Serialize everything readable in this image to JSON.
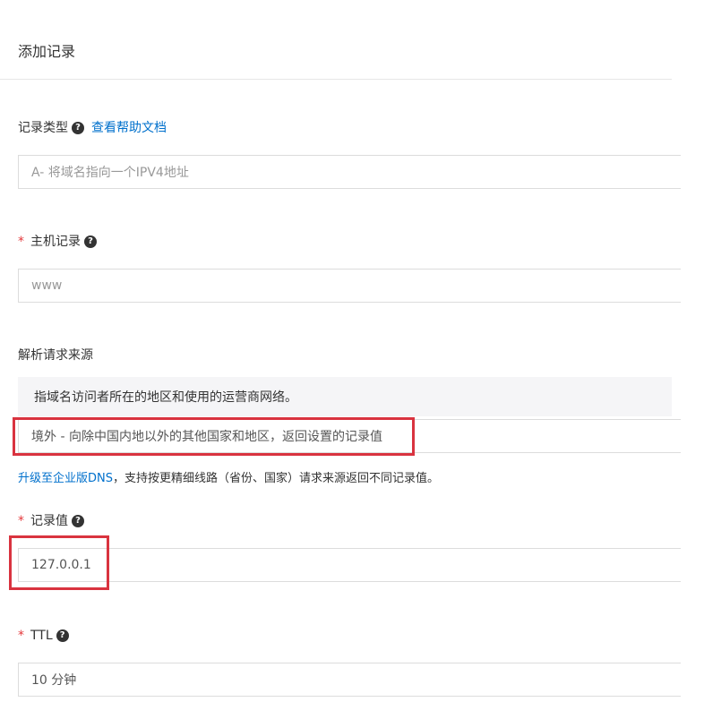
{
  "dialog": {
    "title": "添加记录"
  },
  "record_type": {
    "label": "记录类型",
    "help_link": "查看帮助文档",
    "value": "A- 将域名指向一个IPV4地址"
  },
  "host_record": {
    "required_mark": "*",
    "label": "主机记录",
    "value": "www"
  },
  "request_source": {
    "label": "解析请求来源",
    "hint": "指域名访问者所在的地区和使用的运营商网络。",
    "value": "境外 - 向除中国内地以外的其他国家和地区，返回设置的记录值",
    "upgrade_link": "升级至企业版DNS",
    "upgrade_note": "，支持按更精细线路（省份、国家）请求来源返回不同记录值。"
  },
  "record_value": {
    "required_mark": "*",
    "label": "记录值",
    "value": "127.0.0.1"
  },
  "ttl": {
    "required_mark": "*",
    "label": "TTL",
    "value": "10 分钟"
  },
  "icons": {
    "help": "question-circle-icon"
  },
  "colors": {
    "required": "#e4393c",
    "link": "#0070cc",
    "highlight": "#d9333f"
  }
}
